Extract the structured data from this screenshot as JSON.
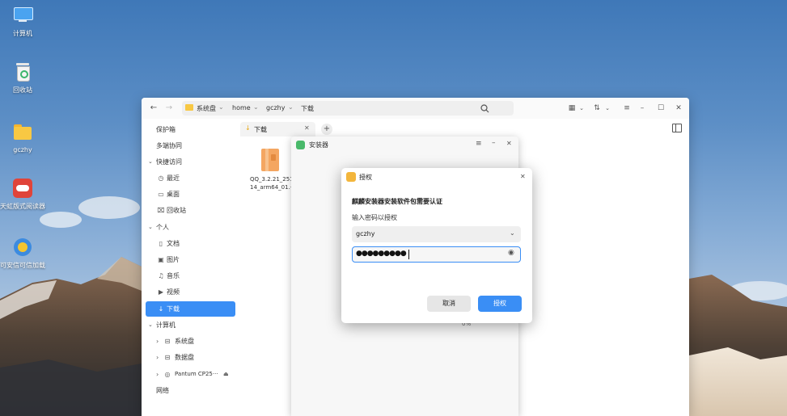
{
  "desktop": {
    "icons": [
      {
        "label": "计算机",
        "icon": "computer-icon"
      },
      {
        "label": "回收站",
        "icon": "trash-icon"
      },
      {
        "label": "gczhy",
        "icon": "folder-icon"
      },
      {
        "label": "天虹版式阅读器",
        "icon": "reader-app-icon"
      },
      {
        "label": "可安信可信加载",
        "icon": "security-app-icon"
      }
    ]
  },
  "file_manager": {
    "breadcrumb": [
      "系统盘",
      "home",
      "gczhy",
      "下载"
    ],
    "tab_label": "下载",
    "sidebar": {
      "top_items": [
        "保护箱",
        "多端协同"
      ],
      "quick_access_header": "快捷访问",
      "quick_access": [
        {
          "label": "最近",
          "icon": "clock-icon"
        },
        {
          "label": "桌面",
          "icon": "desktop-icon"
        },
        {
          "label": "回收站",
          "icon": "trash-icon"
        }
      ],
      "personal_header": "个人",
      "personal": [
        {
          "label": "文档",
          "icon": "document-icon"
        },
        {
          "label": "图片",
          "icon": "picture-icon"
        },
        {
          "label": "音乐",
          "icon": "music-icon"
        },
        {
          "label": "视频",
          "icon": "video-icon"
        },
        {
          "label": "下载",
          "icon": "download-icon"
        }
      ],
      "computer_header": "计算机",
      "computer": [
        {
          "label": "系统盘",
          "icon": "disk-icon"
        },
        {
          "label": "数据盘",
          "icon": "disk-icon"
        },
        {
          "label": "Pantum CP25···",
          "icon": "optical-drive-icon"
        }
      ],
      "network": "网络"
    },
    "file": {
      "name_line1": "QQ_3.2.21_251",
      "name_line2": "14_arm64_01.·"
    }
  },
  "installer": {
    "title": "安装器",
    "progress_text": "0%"
  },
  "auth_dialog": {
    "title": "授权",
    "heading": "麒麟安装器安装软件包需要认证",
    "prompt": "输入密码以授权",
    "user": "gczhy",
    "password_mask": "●●●●●●●●●",
    "cancel_label": "取消",
    "confirm_label": "授权"
  },
  "colors": {
    "accent": "#3a8ef5"
  }
}
